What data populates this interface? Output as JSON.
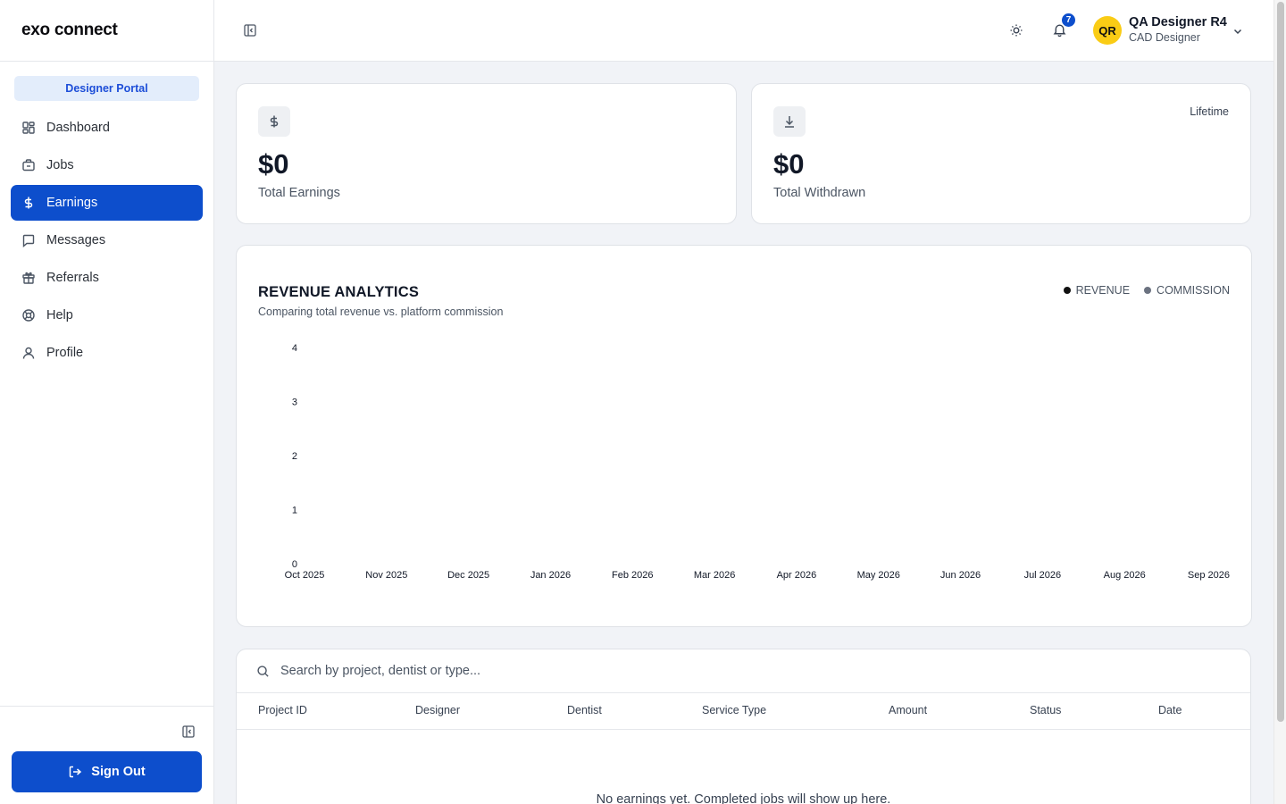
{
  "brand": {
    "name": "exo connect",
    "portal": "Designer Portal"
  },
  "sidebar": {
    "items": [
      {
        "label": "Dashboard",
        "icon": "dashboard-icon"
      },
      {
        "label": "Jobs",
        "icon": "briefcase-icon"
      },
      {
        "label": "Earnings",
        "icon": "dollar-icon",
        "active": true
      },
      {
        "label": "Messages",
        "icon": "message-icon"
      },
      {
        "label": "Referrals",
        "icon": "gift-icon"
      },
      {
        "label": "Help",
        "icon": "lifebuoy-icon"
      },
      {
        "label": "Profile",
        "icon": "user-icon"
      }
    ],
    "sign_out": "Sign Out"
  },
  "header": {
    "notifications_count": "7",
    "user": {
      "initials": "QR",
      "name": "QA Designer R4",
      "role": "CAD Designer"
    }
  },
  "stats": [
    {
      "value": "$0",
      "label": "Total Earnings",
      "icon": "dollar-icon",
      "period": ""
    },
    {
      "value": "$0",
      "label": "Total Withdrawn",
      "icon": "download-icon",
      "period": "Lifetime"
    }
  ],
  "chart_data": {
    "type": "line",
    "title": "REVENUE ANALYTICS",
    "subtitle": "Comparing total revenue vs. platform commission",
    "categories": [
      "Oct 2025",
      "Nov 2025",
      "Dec 2025",
      "Jan 2026",
      "Feb 2026",
      "Mar 2026",
      "Apr 2026",
      "May 2026",
      "Jun 2026",
      "Jul 2026",
      "Aug 2026",
      "Sep 2026"
    ],
    "series": [
      {
        "name": "REVENUE",
        "color": "#111111",
        "values": [
          0,
          0,
          0,
          0,
          0,
          0,
          0,
          0,
          0,
          0,
          0,
          0
        ]
      },
      {
        "name": "COMMISSION",
        "color": "#6b7280",
        "values": [
          0,
          0,
          0,
          0,
          0,
          0,
          0,
          0,
          0,
          0,
          0,
          0
        ]
      }
    ],
    "y_ticks": [
      0,
      1,
      2,
      3,
      4
    ],
    "ylim": [
      0,
      4
    ],
    "grid": false,
    "legend": "top-right"
  },
  "table": {
    "search_placeholder": "Search by project, dentist or type...",
    "columns": [
      "Project ID",
      "Designer",
      "Dentist",
      "Service Type",
      "Amount",
      "Status",
      "Date"
    ],
    "rows": [],
    "empty_message": "No earnings yet. Completed jobs will show up here."
  }
}
